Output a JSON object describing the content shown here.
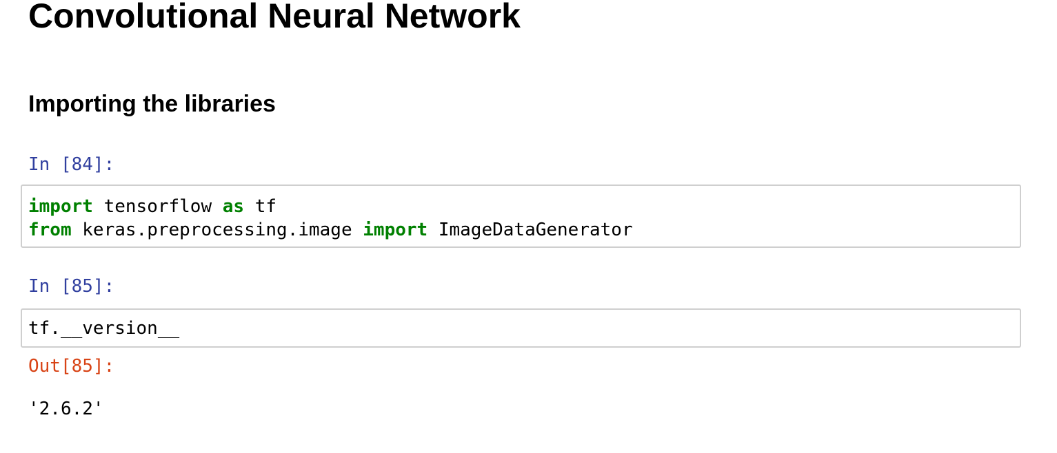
{
  "notebook": {
    "title": "Convolutional Neural Network",
    "section_heading": "Importing the libraries",
    "cells": [
      {
        "prompt": "In [84]:",
        "lines": [
          {
            "t1": "import",
            "t2": " tensorflow ",
            "t3": "as",
            "t4": " tf"
          },
          {
            "t1": "from",
            "t2": " keras.preprocessing.image ",
            "t3": "import",
            "t4": " ImageDataGenerator"
          }
        ]
      },
      {
        "prompt": "In [85]:",
        "code": "tf.__version__",
        "out_prompt": "Out[85]:",
        "output": "'2.6.2'"
      }
    ],
    "colors": {
      "keyword": "#008000",
      "in_prompt": "#303f9f",
      "out_prompt": "#d84315",
      "cell_border": "#cfcfcf"
    }
  }
}
